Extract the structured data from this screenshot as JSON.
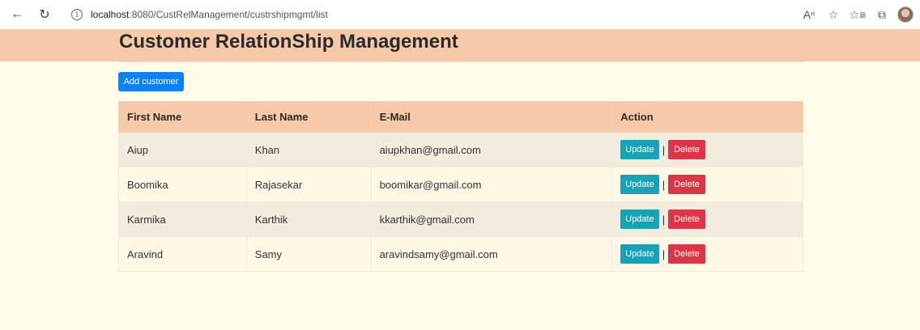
{
  "browser": {
    "url_host": "localhost",
    "url_path": ":8080/CustRelManagement/custrshipmgmt/list"
  },
  "header": {
    "title": "Customer RelationShip Management"
  },
  "actions": {
    "add_label": "Add customer"
  },
  "table": {
    "columns": [
      "First Name",
      "Last Name",
      "E-Mail",
      "Action"
    ],
    "rows": [
      {
        "first": "Aiup",
        "last": "Khan",
        "email": "aiupkhan@gmail.com"
      },
      {
        "first": "Boomika",
        "last": "Rajasekar",
        "email": "boomikar@gmail.com"
      },
      {
        "first": "Karmika",
        "last": "Karthik",
        "email": "kkarthik@gmail.com"
      },
      {
        "first": "Aravind",
        "last": "Samy",
        "email": "aravindsamy@gmail.com"
      }
    ],
    "update_label": "Update",
    "delete_label": "Delete",
    "separator": "|"
  },
  "colors": {
    "header": "#f7c9a8",
    "background": "#fffbea",
    "primary": "#0d80f2",
    "info": "#17a2b8",
    "danger": "#dc3545"
  }
}
